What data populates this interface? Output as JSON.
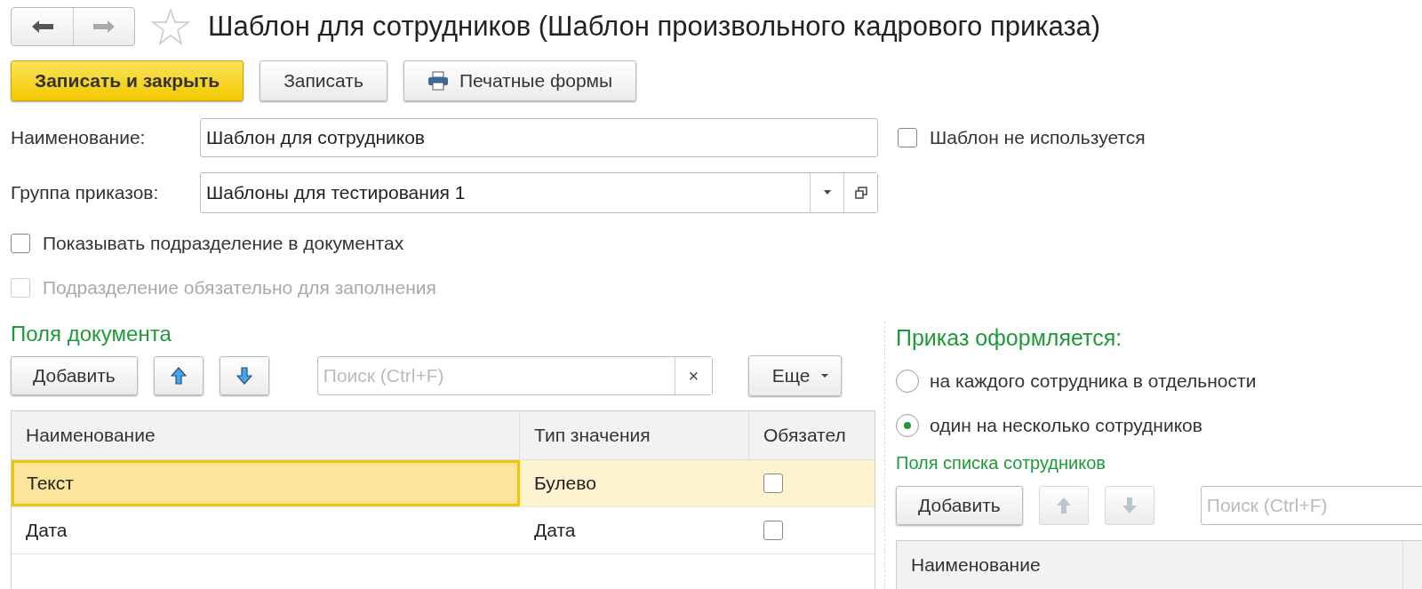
{
  "nav": [
    {
      "kind": "back",
      "disabled": false
    },
    {
      "kind": "forward",
      "disabled": true
    }
  ],
  "title": "Шаблон для сотрудников (Шаблон произвольного кадрового приказа)",
  "commands": [
    {
      "label": "Записать и закрыть",
      "kind": "primary"
    },
    {
      "label": "Записать",
      "kind": "plain"
    },
    {
      "label": "Печатные формы",
      "kind": "print"
    }
  ],
  "name_field": {
    "label": "Наименование:",
    "value": "Шаблон для сотрудников"
  },
  "unused_checkbox": {
    "label": "Шаблон не используется",
    "checked": false
  },
  "group_field": {
    "label": "Группа приказов:",
    "value": "Шаблоны для тестирования 1"
  },
  "options": [
    {
      "label": "Показывать подразделение в документах",
      "checked": false,
      "disabled": false
    },
    {
      "label": "Подразделение обязательно для заполнения",
      "checked": false,
      "disabled": true
    }
  ],
  "document_fields": {
    "title": "Поля документа",
    "add_label": "Добавить",
    "up_disabled": false,
    "down_disabled": false,
    "search_placeholder": "Поиск (Ctrl+F)",
    "clear_label": "×",
    "more_label": "Еще",
    "columns": [
      "Наименование",
      "Тип значения",
      "Обязател"
    ],
    "rows": [
      {
        "name": "Текст",
        "type": "Булево",
        "required": false,
        "selected": true
      },
      {
        "name": "Дата",
        "type": "Дата",
        "required": false,
        "selected": false
      }
    ]
  },
  "order_mode": {
    "title": "Приказ оформляется:",
    "options": [
      {
        "label": "на каждого сотрудника в отдельности",
        "selected": false
      },
      {
        "label": "один на несколько сотрудников",
        "selected": true
      }
    ]
  },
  "employee_fields": {
    "title": "Поля списка сотрудников",
    "add_label": "Добавить",
    "up_disabled": true,
    "down_disabled": true,
    "search_placeholder": "Поиск (Ctrl+F)",
    "columns": [
      "Наименование"
    ]
  }
}
